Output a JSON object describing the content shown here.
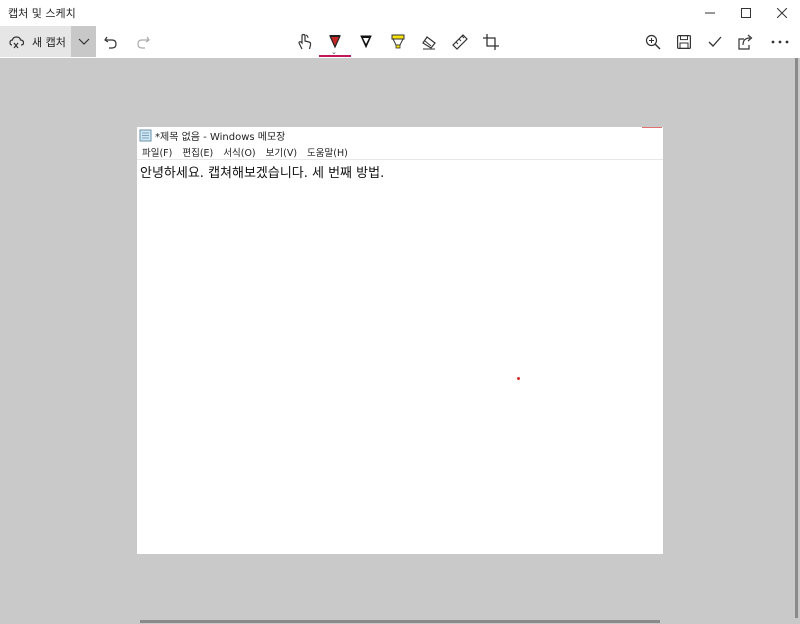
{
  "app": {
    "title": "캡처 및 스케치"
  },
  "toolbar": {
    "new_capture_label": "새 캡처",
    "icons": [
      "capture-icon",
      "chevron-down-icon",
      "undo-icon",
      "redo-icon",
      "touch-writing-icon",
      "ballpoint-pen-icon",
      "pencil-icon",
      "highlighter-icon",
      "eraser-icon",
      "ruler-icon",
      "crop-icon",
      "zoom-icon",
      "save-icon",
      "checkmark-icon",
      "share-icon",
      "more-icon"
    ],
    "pen_color": "#c2185b"
  },
  "window_controls": [
    "minimize-icon",
    "maximize-icon",
    "close-icon"
  ],
  "notepad": {
    "title": "*제목 없음 - Windows 메모장",
    "menu": [
      "파일(F)",
      "편집(E)",
      "서식(O)",
      "보기(V)",
      "도움말(H)"
    ],
    "content": "안녕하세요. 캡쳐해보겠습니다. 세 번째 방법."
  }
}
